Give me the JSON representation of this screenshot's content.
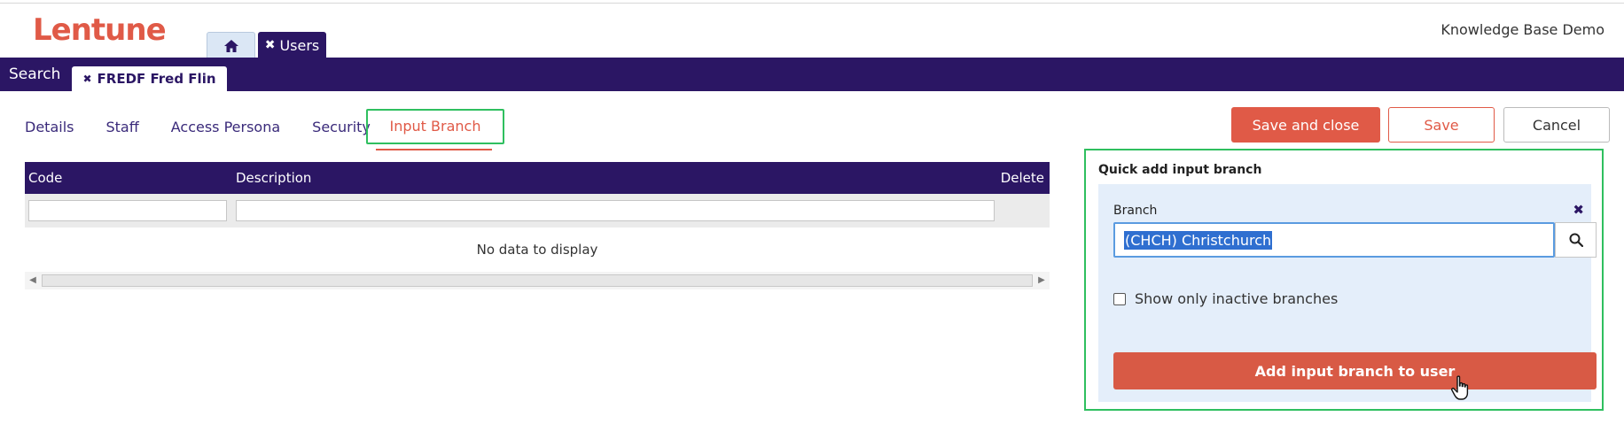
{
  "brand": {
    "logo": "Lentune",
    "accent": "#e05a47",
    "primary": "#2b1664",
    "highlight": "#2fbf5f"
  },
  "top_tabs": [
    {
      "icon": "home-icon"
    },
    {
      "icon": "close-icon",
      "label": "Users"
    }
  ],
  "app_title": "Knowledge Base Demo",
  "nav": {
    "search_label": "Search",
    "record_tab": {
      "icon": "close-icon",
      "label": "FREDF Fred Flin"
    }
  },
  "subtabs": [
    "Details",
    "Staff",
    "Access Persona",
    "Security",
    "Input Branch"
  ],
  "active_subtab": "Input Branch",
  "actions": {
    "save_close": "Save and close",
    "save": "Save",
    "cancel": "Cancel"
  },
  "grid": {
    "columns": [
      "Code",
      "Description",
      "Delete"
    ],
    "empty_text": "No data to display"
  },
  "quick_add": {
    "title": "Quick add input branch",
    "branch_label": "Branch",
    "branch_value": "(CHCH) Christchurch",
    "inactive_label": "Show only inactive branches",
    "inactive_checked": false,
    "add_button": "Add input branch to user"
  }
}
